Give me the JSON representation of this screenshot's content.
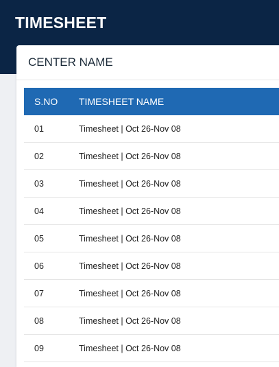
{
  "header": {
    "title": "TIMESHEET"
  },
  "card": {
    "title": "CENTER NAME"
  },
  "table": {
    "columns": [
      "S.NO",
      "TIMESHEET NAME"
    ],
    "rows": [
      {
        "sno": "01",
        "name": "Timesheet | Oct 26-Nov 08"
      },
      {
        "sno": "02",
        "name": "Timesheet | Oct 26-Nov 08"
      },
      {
        "sno": "03",
        "name": "Timesheet | Oct 26-Nov 08"
      },
      {
        "sno": "04",
        "name": "Timesheet | Oct 26-Nov 08"
      },
      {
        "sno": "05",
        "name": "Timesheet | Oct 26-Nov 08"
      },
      {
        "sno": "06",
        "name": "Timesheet | Oct 26-Nov 08"
      },
      {
        "sno": "07",
        "name": "Timesheet | Oct 26-Nov 08"
      },
      {
        "sno": "08",
        "name": "Timesheet | Oct 26-Nov 08"
      },
      {
        "sno": "09",
        "name": "Timesheet | Oct 26-Nov 08"
      }
    ]
  },
  "colors": {
    "header_bg": "#0b2545",
    "table_header_bg": "#1f69b3",
    "card_bg": "#ffffff",
    "page_bg": "#eef0f3"
  }
}
